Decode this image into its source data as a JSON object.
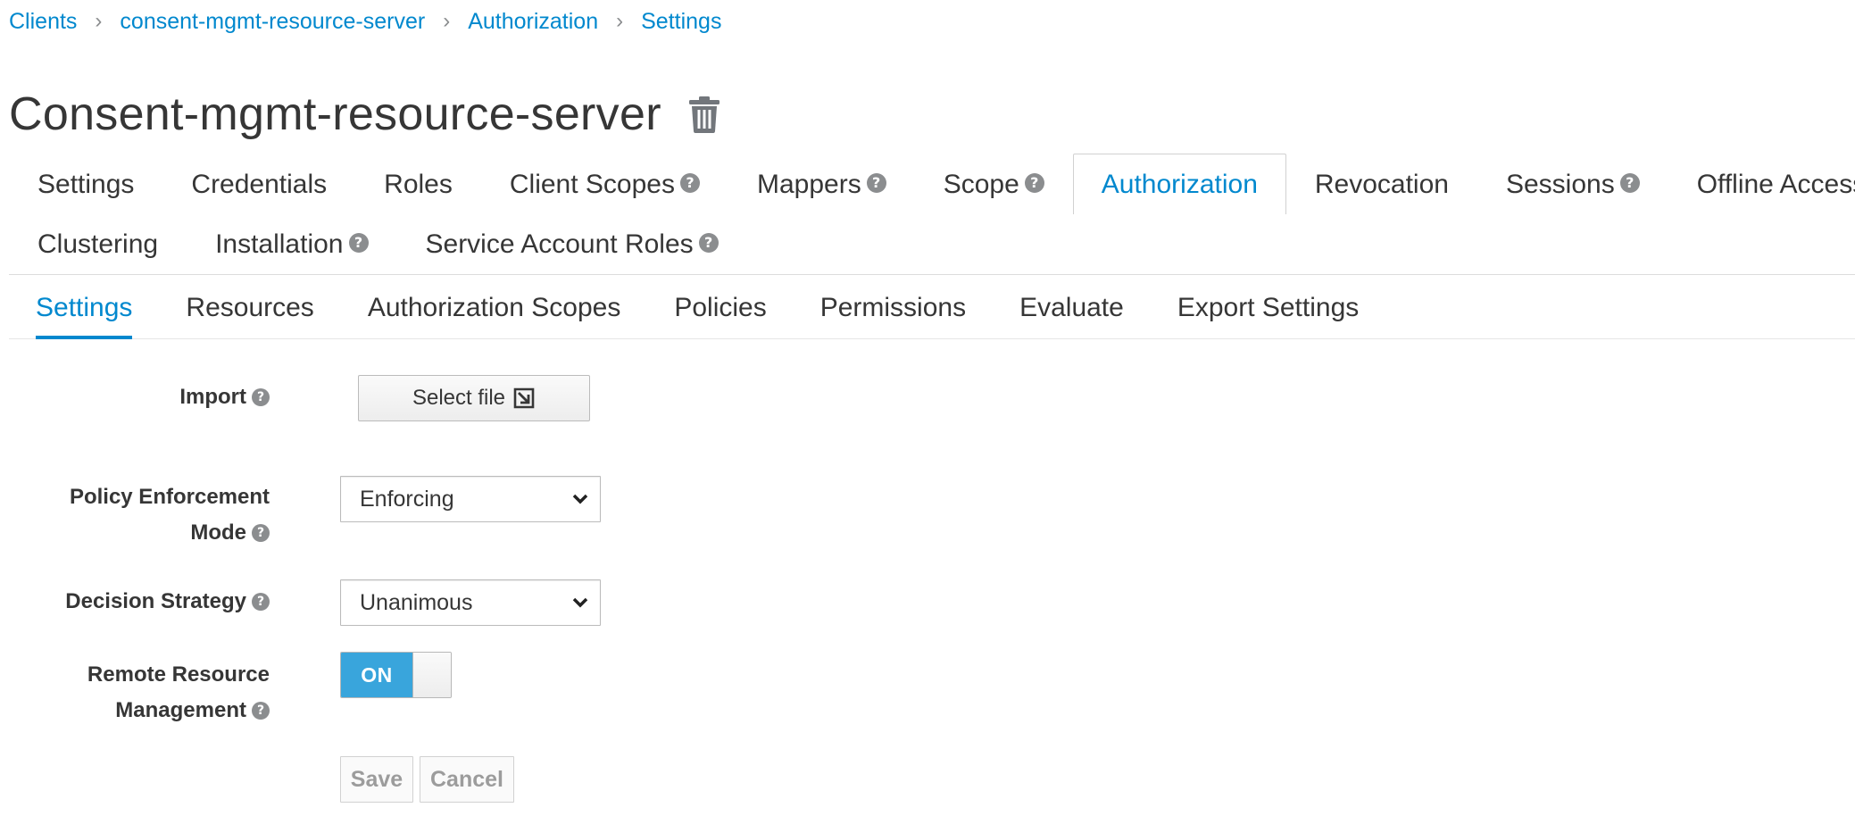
{
  "breadcrumb": [
    "Clients",
    "consent-mgmt-resource-server",
    "Authorization",
    "Settings"
  ],
  "page_title": "Consent-mgmt-resource-server",
  "main_tabs": {
    "settings": "Settings",
    "credentials": "Credentials",
    "roles": "Roles",
    "client_scopes": "Client Scopes",
    "mappers": "Mappers",
    "scope": "Scope",
    "authorization": "Authorization",
    "revocation": "Revocation",
    "sessions": "Sessions",
    "offline_access": "Offline Access",
    "clustering": "Clustering",
    "installation": "Installation",
    "service_account_roles": "Service Account Roles"
  },
  "sub_tabs": [
    "Settings",
    "Resources",
    "Authorization Scopes",
    "Policies",
    "Permissions",
    "Evaluate",
    "Export Settings"
  ],
  "form": {
    "import_label": "Import",
    "select_file_label": "Select file",
    "policy_label_line1": "Policy Enforcement",
    "policy_label_line2": "Mode",
    "policy_value": "Enforcing",
    "decision_label": "Decision Strategy",
    "decision_value": "Unanimous",
    "remote_label_line1": "Remote Resource",
    "remote_label_line2": "Management",
    "remote_toggle": "ON"
  },
  "buttons": {
    "save": "Save",
    "cancel": "Cancel"
  },
  "help_glyph": "?",
  "colors": {
    "link": "#0088ce",
    "toggle_on": "#39a5dc",
    "text": "#363636"
  }
}
